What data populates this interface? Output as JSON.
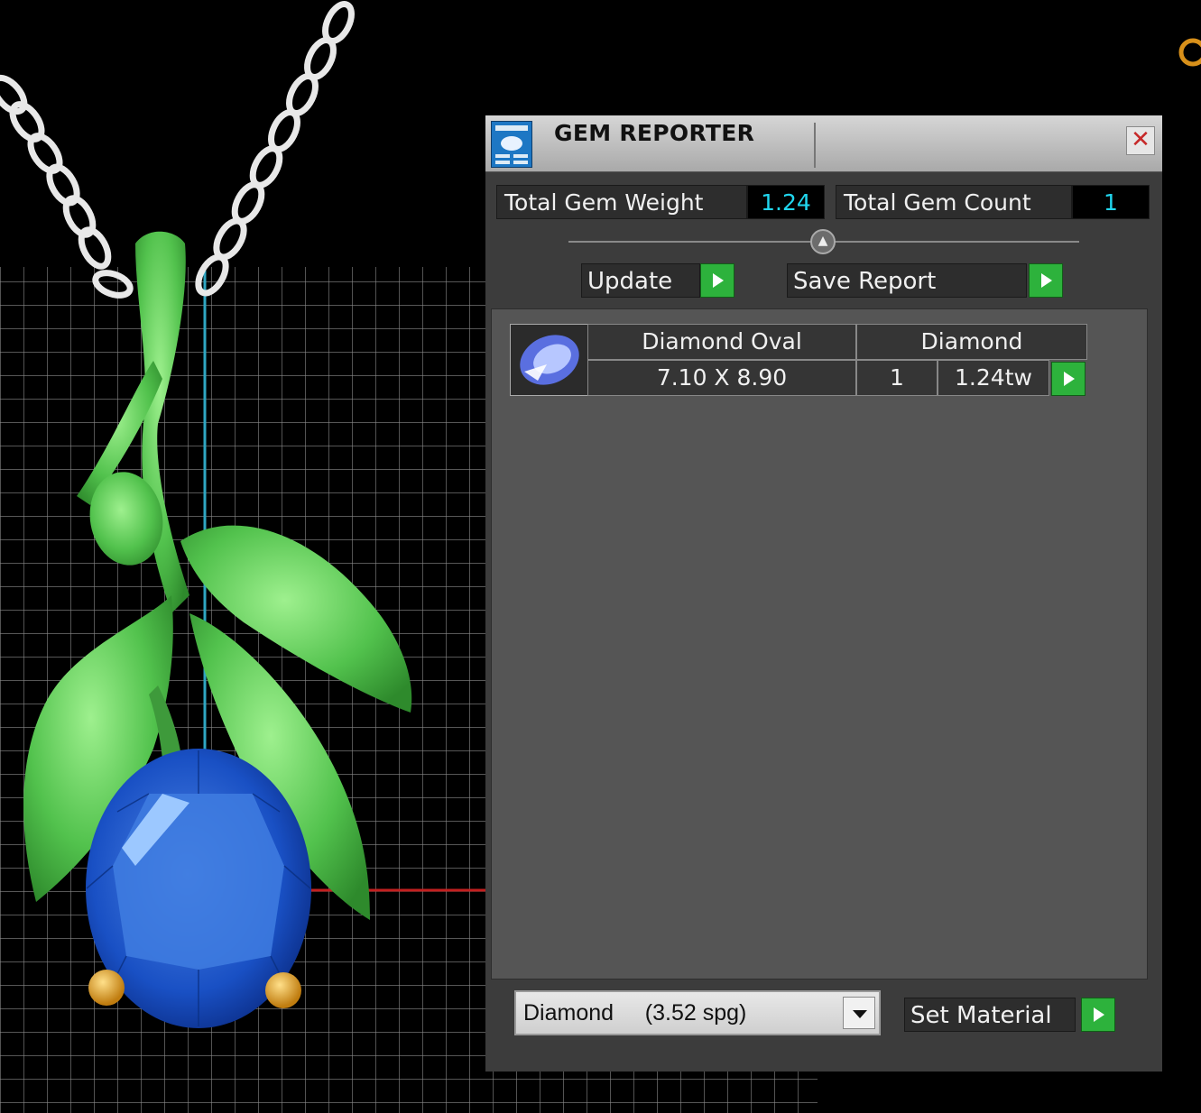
{
  "panel": {
    "title": "GEM REPORTER",
    "close_glyph": "✕",
    "total_weight_label": "Total Gem Weight",
    "total_weight_value": "1.24",
    "total_count_label": "Total Gem Count",
    "total_count_value": "1",
    "update_label": "Update",
    "save_report_label": "Save Report",
    "gems": [
      {
        "name": "Diamond Oval",
        "material": "Diamond",
        "size": "7.10 X 8.90",
        "count": "1",
        "weight": "1.24tw"
      }
    ],
    "material_select": {
      "selected": "Diamond     (3.52 spg)"
    },
    "set_material_label": "Set Material"
  },
  "colors": {
    "accent_value": "#21d6ee",
    "go_button": "#2db23c",
    "gem_blue": "#1346b8",
    "metal_green": "#5fd15f",
    "prong_gold": "#e0a020"
  },
  "icons": {
    "app": "gem-reporter-icon",
    "close": "close-icon",
    "go": "play-arrow-icon",
    "thumb": "oval-gem-icon",
    "dropdown": "chevron-down-icon"
  }
}
